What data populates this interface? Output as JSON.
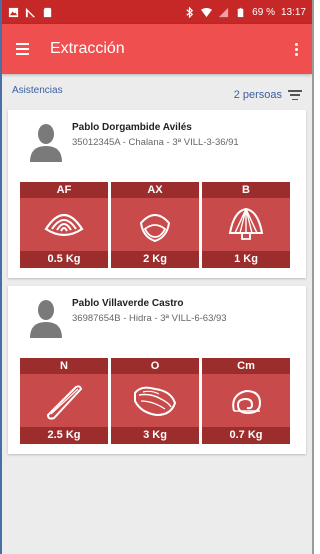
{
  "status": {
    "battery_pct": "69 %",
    "time": "13:17"
  },
  "appbar": {
    "title": "Extracción"
  },
  "subheader": {
    "section_label": "Asistencias",
    "persons_count": "2 persoas"
  },
  "cards": [
    {
      "name": "Pablo Dorgambide Avilés",
      "details": "35012345A - Chalana - 3ª VILL-3-36/91",
      "tiles": [
        {
          "code": "AF",
          "weight": "0.5 Kg",
          "icon": "clam-shell-icon"
        },
        {
          "code": "AX",
          "weight": "2 Kg",
          "icon": "cockle-shell-icon"
        },
        {
          "code": "B",
          "weight": "1 Kg",
          "icon": "scallop-shell-icon"
        }
      ]
    },
    {
      "name": "Pablo Villaverde Castro",
      "details": "36987654B - Hidra - 3ª VILL-6-63/93",
      "tiles": [
        {
          "code": "N",
          "weight": "2.5 Kg",
          "icon": "razor-clam-icon"
        },
        {
          "code": "O",
          "weight": "3 Kg",
          "icon": "oyster-icon"
        },
        {
          "code": "Cm",
          "weight": "0.7 Kg",
          "icon": "snail-shell-icon"
        }
      ]
    }
  ],
  "colors": {
    "appbar": "#ef4f4f",
    "statusbar": "#c62828",
    "tile": "#c94a4a",
    "tile_band": "#9b2d2d",
    "link": "#3b5fa0"
  }
}
